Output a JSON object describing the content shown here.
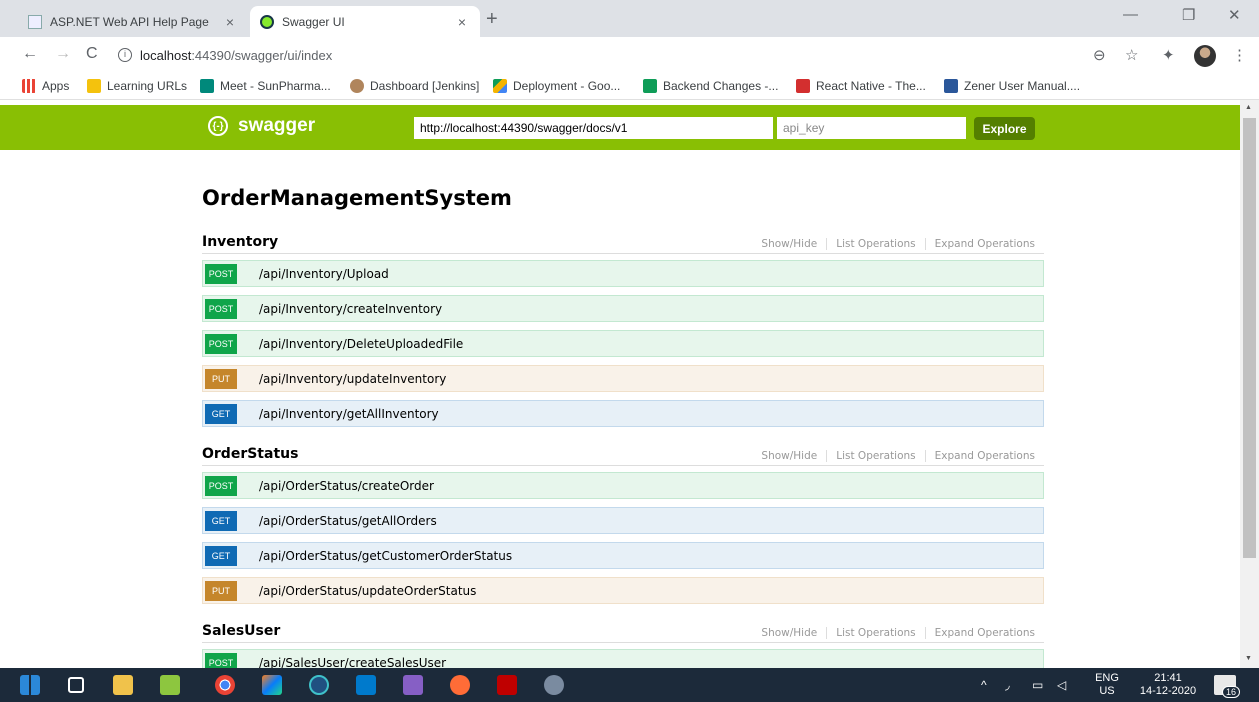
{
  "browser": {
    "tabs": [
      {
        "title": "ASP.NET Web API Help Page",
        "active": false
      },
      {
        "title": "Swagger UI",
        "active": true
      }
    ],
    "tab_close_glyph": "×",
    "new_tab_glyph": "+",
    "window_controls": [
      "—",
      "❐",
      "✕"
    ],
    "address": {
      "host": "localhost",
      "path": ":44390/swagger/ui/index"
    },
    "nav": {
      "back": "←",
      "forward": "→",
      "reload": "C"
    },
    "right_icons": {
      "zoom": "⊖",
      "star": "☆",
      "extensions": "✦",
      "menu": "⋮"
    }
  },
  "bookmarks": [
    {
      "label": "Apps",
      "icon_color": "#1a73e8"
    },
    {
      "label": "Learning URLs",
      "icon_color": "#f4c20d"
    },
    {
      "label": "Meet - SunPharma...",
      "icon_color": "#00897b"
    },
    {
      "label": "Dashboard [Jenkins]",
      "icon_color": "#b0855c"
    },
    {
      "label": "Deployment - Goo...",
      "icon_color": "#4285f4"
    },
    {
      "label": "Backend Changes -...",
      "icon_color": "#0f9d58"
    },
    {
      "label": "React Native - The...",
      "icon_color": "#d32f2f"
    },
    {
      "label": "Zener User Manual....",
      "icon_color": "#2b579a"
    }
  ],
  "swagger": {
    "brand": "swagger",
    "logo_glyph": "{-}",
    "url_value": "http://localhost:44390/swagger/docs/v1",
    "api_key_placeholder": "api_key",
    "explore_label": "Explore",
    "header_color": "#89bf04"
  },
  "api_title": "OrderManagementSystem",
  "section_links": [
    "Show/Hide",
    "List Operations",
    "Expand Operations"
  ],
  "sections": [
    {
      "name": "Inventory",
      "operations": [
        {
          "method": "POST",
          "path": "/api/Inventory/Upload"
        },
        {
          "method": "POST",
          "path": "/api/Inventory/createInventory"
        },
        {
          "method": "POST",
          "path": "/api/Inventory/DeleteUploadedFile"
        },
        {
          "method": "PUT",
          "path": "/api/Inventory/updateInventory"
        },
        {
          "method": "GET",
          "path": "/api/Inventory/getAllInventory"
        }
      ]
    },
    {
      "name": "OrderStatus",
      "operations": [
        {
          "method": "POST",
          "path": "/api/OrderStatus/createOrder"
        },
        {
          "method": "GET",
          "path": "/api/OrderStatus/getAllOrders"
        },
        {
          "method": "GET",
          "path": "/api/OrderStatus/getCustomerOrderStatus"
        },
        {
          "method": "PUT",
          "path": "/api/OrderStatus/updateOrderStatus"
        }
      ]
    },
    {
      "name": "SalesUser",
      "operations": [
        {
          "method": "POST",
          "path": "/api/SalesUser/createSalesUser"
        }
      ]
    }
  ],
  "method_colors": {
    "POST": "#10a54a",
    "GET": "#0f6ab4",
    "PUT": "#c5862b"
  },
  "taskbar": {
    "lang_top": "ENG",
    "lang_bottom": "US",
    "time": "21:41",
    "date": "14-12-2020",
    "notifications": "16",
    "apps": [
      "windows-start",
      "task-view",
      "file-explorer",
      "notepad-plus",
      "chrome",
      "jetbrains",
      "sourcetree",
      "vscode",
      "visual-studio",
      "postman",
      "filezilla",
      "snipping-tool"
    ]
  }
}
